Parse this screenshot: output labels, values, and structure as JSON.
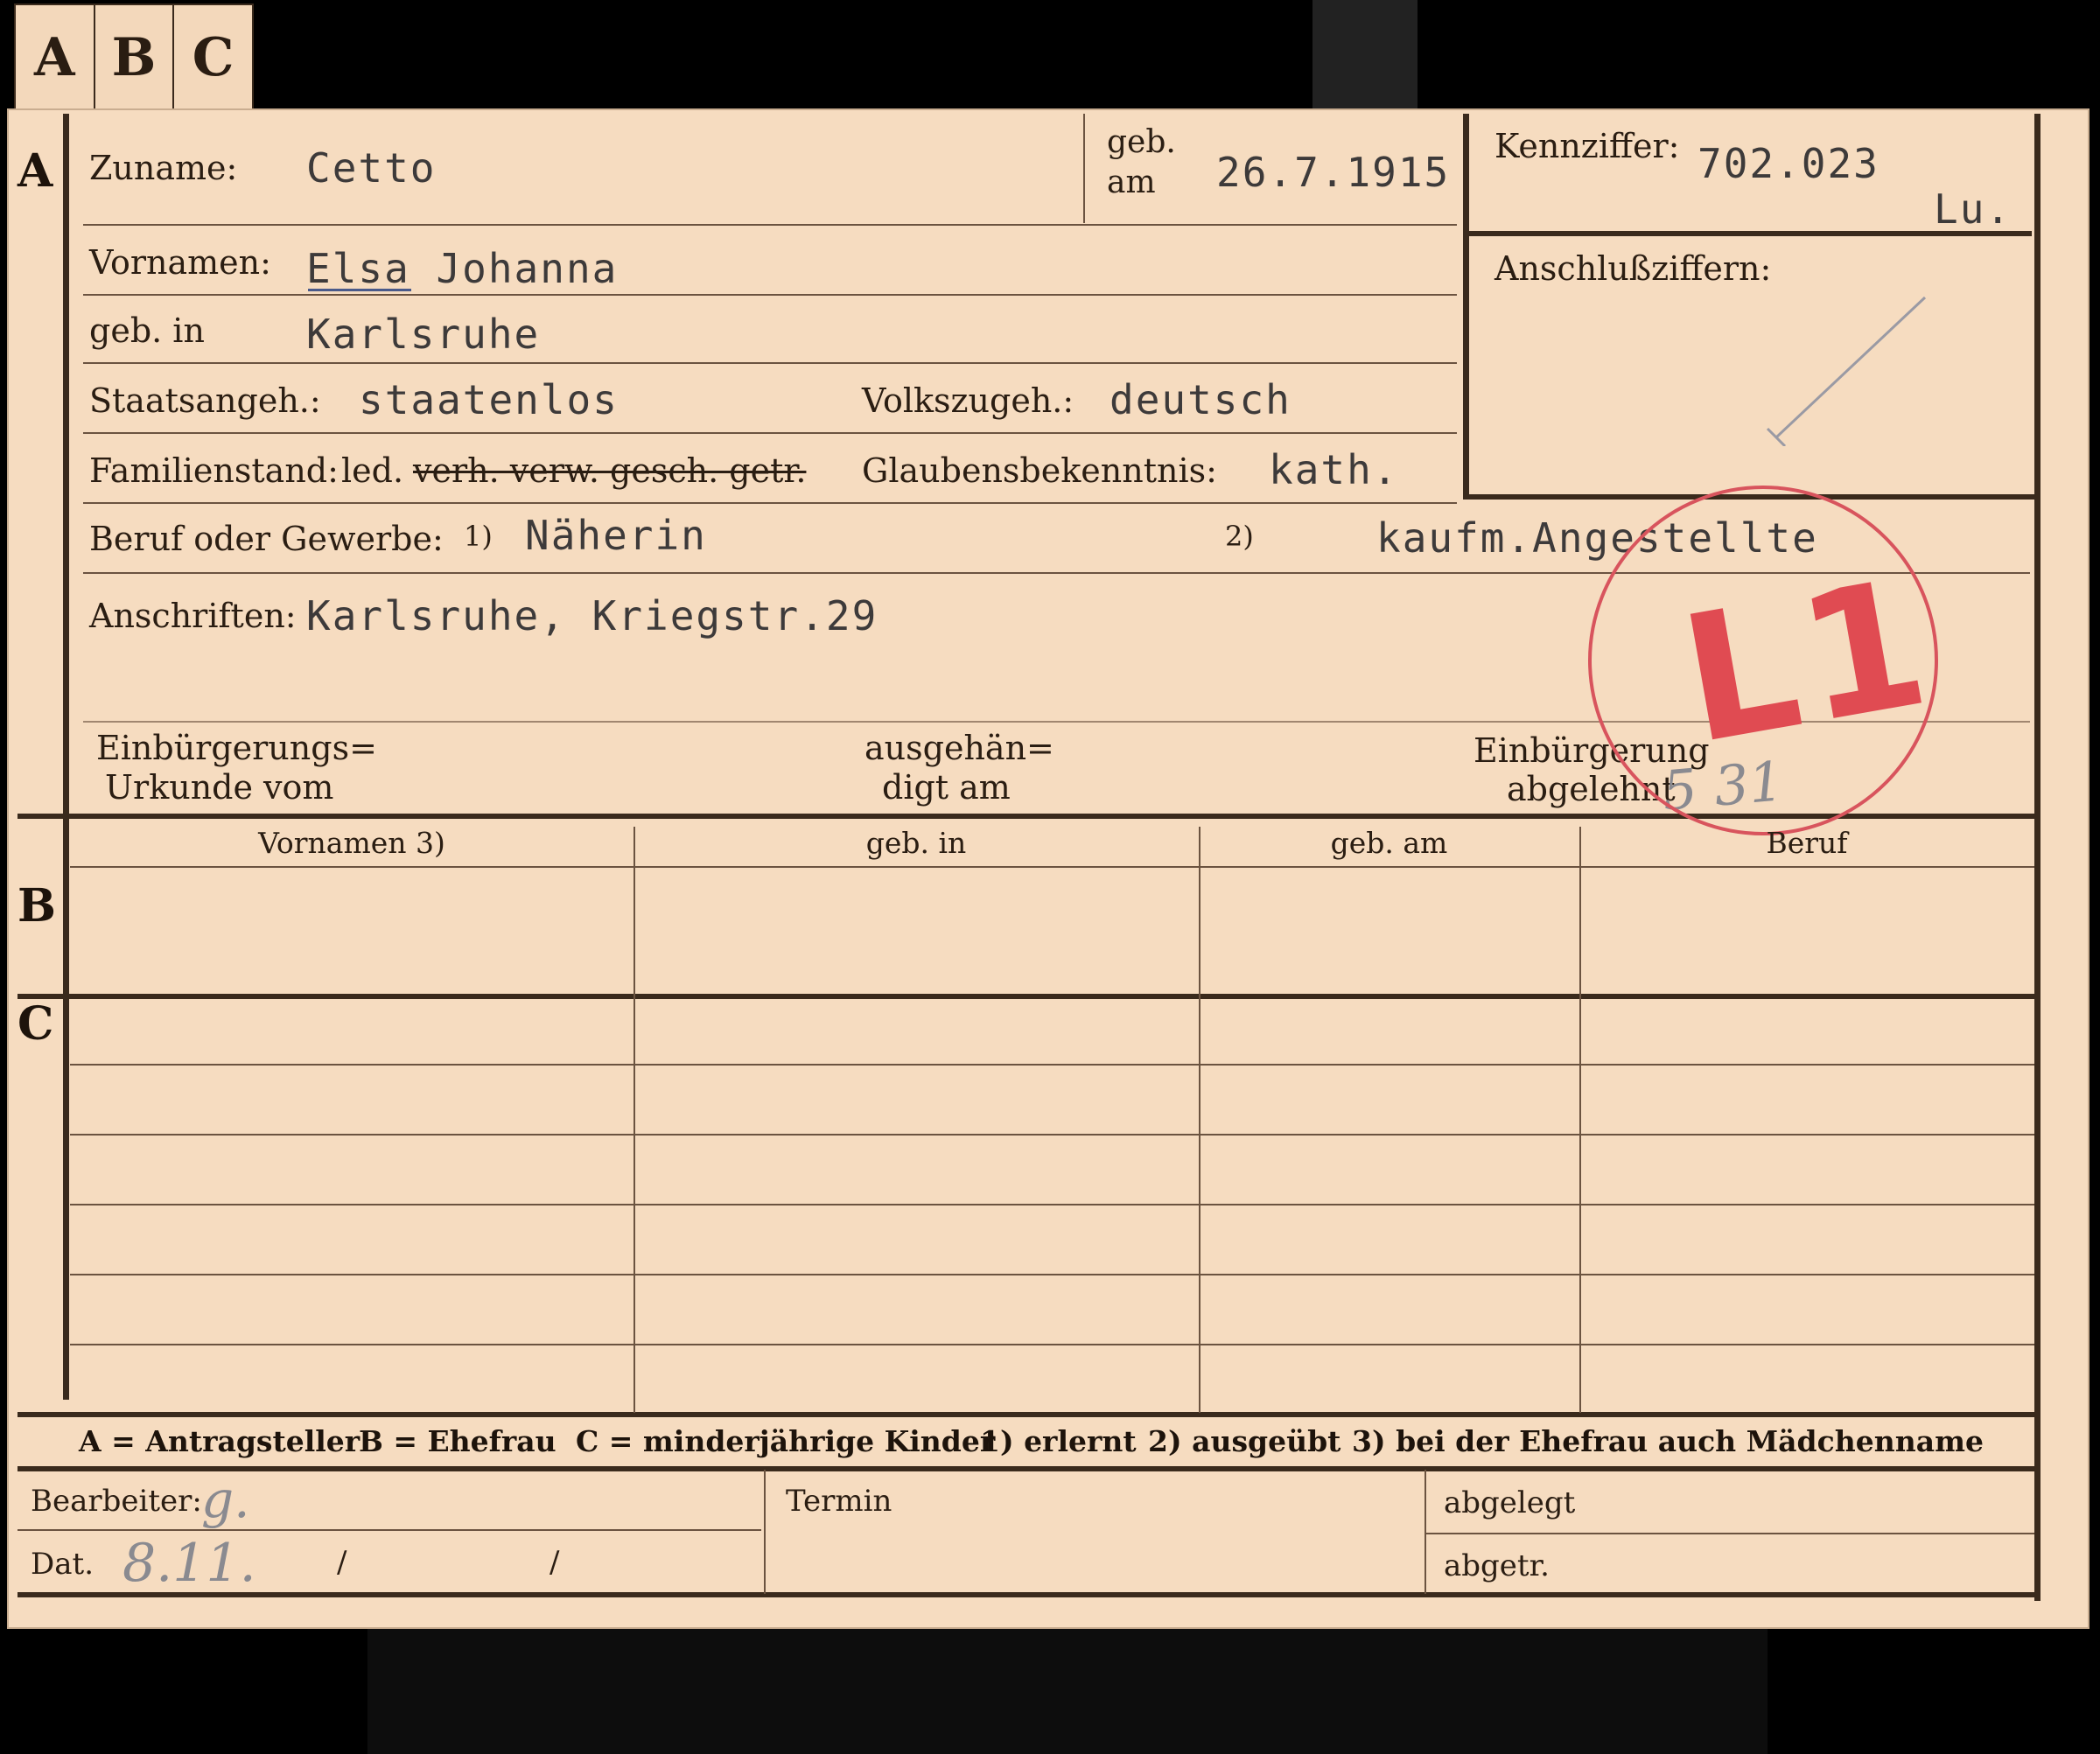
{
  "tabs": [
    "A",
    "B",
    "C"
  ],
  "row_marks": {
    "a": "A",
    "b": "B",
    "c": "C"
  },
  "section_a": {
    "zuname_label": "Zuname:",
    "zuname_value": "Cetto",
    "geb_am_label_1": "geb.",
    "geb_am_label_2": "am",
    "geb_am_value": "26.7.1915",
    "kennziffer_label": "Kennziffer:",
    "kennziffer_value": "702.023",
    "kennziffer_suffix": "Lu.",
    "anschlussziffern_label": "Anschlußziffern:",
    "vornamen_label": "Vornamen:",
    "vornamen_value": "Elsa Johanna",
    "geb_in_label": "geb. in",
    "geb_in_value": "Karlsruhe",
    "staatsangeh_label": "Staatsangeh.:",
    "staatsangeh_value": "staatenlos",
    "volkszugeh_label": "Volkszugeh.:",
    "volkszugeh_value": "deutsch",
    "familienstand_label": "Familienstand:",
    "familienstand_led": "led.",
    "familienstand_struck": "verh. verw. gesch. getr.",
    "glaubens_label": "Glaubensbekenntnis:",
    "glaubens_value": "kath.",
    "beruf_label": "Beruf oder Gewerbe:",
    "beruf_1_mark": "1)",
    "beruf_1_value": "Näherin",
    "beruf_2_mark": "2)",
    "beruf_2_value": "kaufm.Angestellte",
    "anschriften_label": "Anschriften:",
    "anschriften_value": "Karlsruhe, Kriegstr.29",
    "einbuergerungs_label_1": "Einbürgerungs=",
    "einbuergerungs_label_2": "Urkunde vom",
    "ausgehaen_label_1": "ausgehän=",
    "ausgehaen_label_2": "digt am",
    "abgelehnt_label_1": "Einbürgerung",
    "abgelehnt_label_2": "abgelehnt",
    "abgelehnt_hand": "5 31",
    "stamp_text": "L1"
  },
  "section_b": {
    "columns": [
      "Vornamen 3)",
      "geb. in",
      "geb. am",
      "Beruf"
    ]
  },
  "legend": {
    "a": "A = Antragsteller",
    "b": "B = Ehefrau",
    "c": "C = minderjährige Kinder",
    "n1": "1) erlernt",
    "n2": "2) ausgeübt",
    "n3": "3) bei der Ehefrau auch Mädchenname"
  },
  "footer": {
    "bearbeiter_label": "Bearbeiter:",
    "bearbeiter_hand": "g.",
    "dat_label": "Dat.",
    "dat_hand": "8.11.",
    "dat_slash1": "/",
    "dat_slash2": "/",
    "termin_label": "Termin",
    "abgelegt_label": "abgelegt",
    "abgetr_label": "abgetr."
  }
}
